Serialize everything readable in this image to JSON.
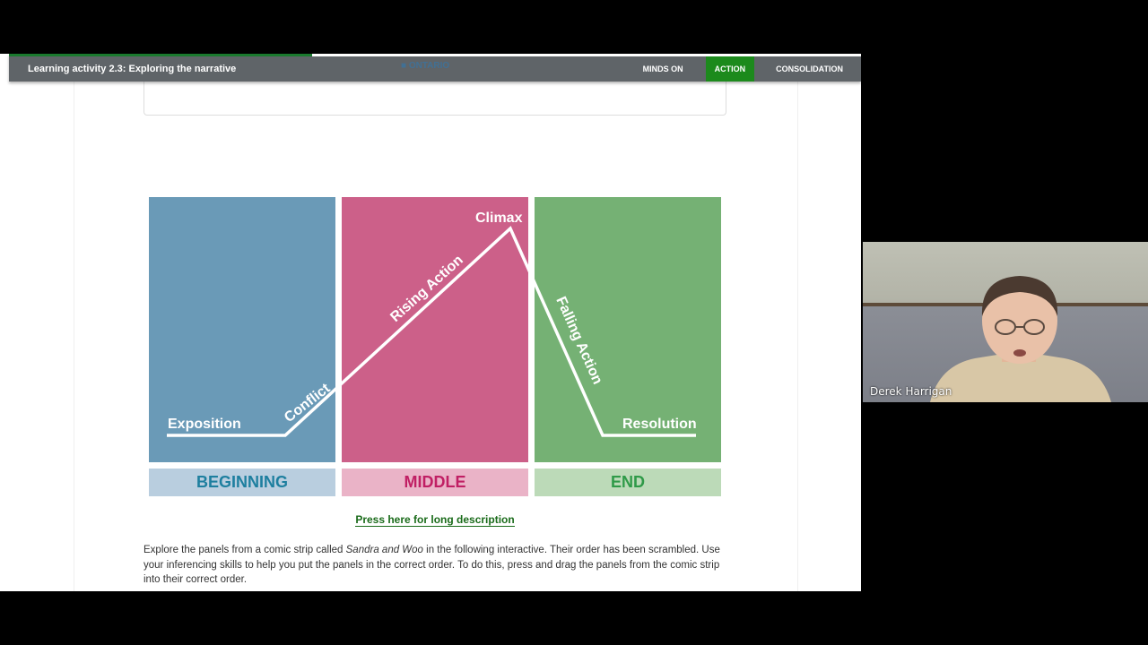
{
  "topbar": {
    "title": "Learning activity 2.3: Exploring the narrative",
    "logo_text": "■ ONTARIO",
    "tabs": [
      {
        "label": "MINDS ON",
        "active": false
      },
      {
        "label": "ACTION",
        "active": true
      },
      {
        "label": "CONSOLIDATION",
        "active": false
      }
    ]
  },
  "diagram": {
    "labels": {
      "exposition": "Exposition",
      "conflict": "Conflict",
      "rising_action": "Rising Action",
      "climax": "Climax",
      "falling_action": "Falling Action",
      "resolution": "Resolution"
    },
    "sections": {
      "beginning": "BEGINNING",
      "middle": "MIDDLE",
      "end": "END"
    },
    "colors": {
      "beginning": "#6a9ab7",
      "middle": "#cc6089",
      "end": "#75b174"
    }
  },
  "long_description_link": "Press here for long description",
  "instructions": {
    "part1": "Explore the panels from a comic strip called ",
    "title": "Sandra and Woo",
    "part2": " in the following interactive. Their order has been scrambled. Use your inferencing skills to help you put the panels in the correct order. To do this, press and drag the panels from the comic strip into their correct order."
  },
  "participant": {
    "name": "Derek Harrigan"
  }
}
